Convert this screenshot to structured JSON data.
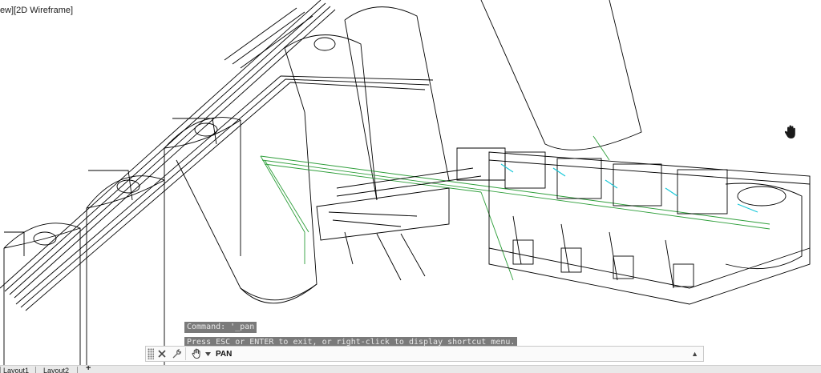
{
  "viewport": {
    "label": "ew][2D Wireframe]",
    "line_color": "#000000",
    "accent_green": "#2e9e3a",
    "accent_cyan": "#18c8d8"
  },
  "cursor": {
    "icon": "pan-hand-icon"
  },
  "command_history": {
    "line1": "Command: '_pan",
    "line2": "Press ESC or ENTER to exit, or right-click to display shortcut menu."
  },
  "command_bar": {
    "prompt": "PAN",
    "icons": [
      "grip-icon",
      "close-icon",
      "customize-wrench-icon",
      "pan-hand-icon",
      "dropdown-triangle-icon"
    ],
    "history_caret": "▲"
  },
  "layout_tabs": {
    "items": [
      "Layout1",
      "Layout2"
    ],
    "add_label": "+"
  }
}
